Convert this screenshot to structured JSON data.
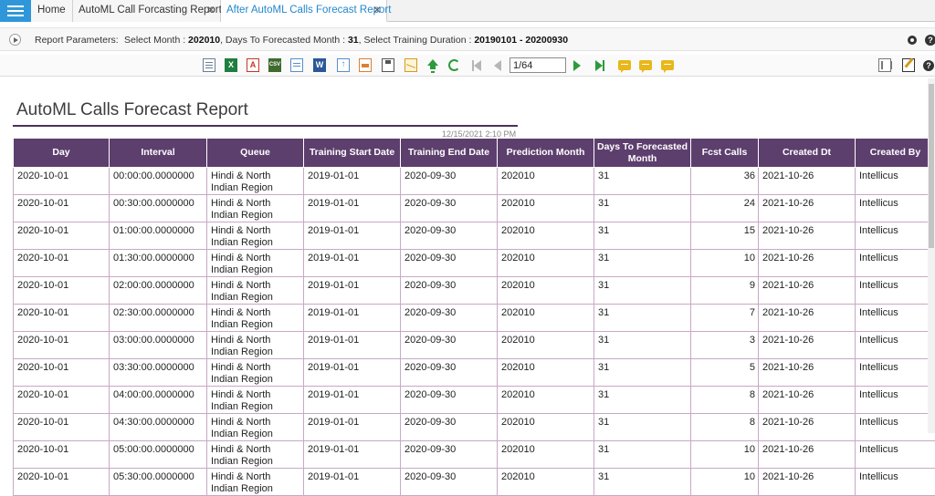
{
  "tabs": [
    {
      "label": "Home"
    },
    {
      "label": "AutoML Call Forcasting Report",
      "close": "✕"
    },
    {
      "label": "After AutoML Calls Forecast Report",
      "close": "✕"
    }
  ],
  "params": {
    "label": "Report Parameters:",
    "pre1": "Select Month : ",
    "val1": "202010",
    "pre2": ", Days To Forecasted Month : ",
    "val2": "31",
    "pre3": ", Select Training Duration : ",
    "val3": "20190101 - 20200930"
  },
  "toolbar": {
    "page_value": "1/64",
    "xls_glyph": "X",
    "pdf_glyph": "A",
    "csv_glyph": "CSV",
    "word_glyph": "W",
    "help_glyph": "?"
  },
  "report": {
    "title": "AutoML Calls Forecast Report",
    "datetime": "12/15/2021  2:10 PM",
    "columns": [
      "Day",
      "Interval",
      "Queue",
      "Training Start Date",
      "Training End Date",
      "Prediction Month",
      "Days To Forecasted Month",
      "Fcst Calls",
      "Created Dt",
      "Created By"
    ],
    "rows": [
      [
        "2020-10-01",
        "00:00:00.0000000",
        "Hindi & North Indian Region",
        "2019-01-01",
        "2020-09-30",
        "202010",
        "31",
        "36",
        "2021-10-26",
        "Intellicus"
      ],
      [
        "2020-10-01",
        "00:30:00.0000000",
        "Hindi & North Indian Region",
        "2019-01-01",
        "2020-09-30",
        "202010",
        "31",
        "24",
        "2021-10-26",
        "Intellicus"
      ],
      [
        "2020-10-01",
        "01:00:00.0000000",
        "Hindi & North Indian Region",
        "2019-01-01",
        "2020-09-30",
        "202010",
        "31",
        "15",
        "2021-10-26",
        "Intellicus"
      ],
      [
        "2020-10-01",
        "01:30:00.0000000",
        "Hindi & North Indian Region",
        "2019-01-01",
        "2020-09-30",
        "202010",
        "31",
        "10",
        "2021-10-26",
        "Intellicus"
      ],
      [
        "2020-10-01",
        "02:00:00.0000000",
        "Hindi & North Indian Region",
        "2019-01-01",
        "2020-09-30",
        "202010",
        "31",
        "9",
        "2021-10-26",
        "Intellicus"
      ],
      [
        "2020-10-01",
        "02:30:00.0000000",
        "Hindi & North Indian Region",
        "2019-01-01",
        "2020-09-30",
        "202010",
        "31",
        "7",
        "2021-10-26",
        "Intellicus"
      ],
      [
        "2020-10-01",
        "03:00:00.0000000",
        "Hindi & North Indian Region",
        "2019-01-01",
        "2020-09-30",
        "202010",
        "31",
        "3",
        "2021-10-26",
        "Intellicus"
      ],
      [
        "2020-10-01",
        "03:30:00.0000000",
        "Hindi & North Indian Region",
        "2019-01-01",
        "2020-09-30",
        "202010",
        "31",
        "5",
        "2021-10-26",
        "Intellicus"
      ],
      [
        "2020-10-01",
        "04:00:00.0000000",
        "Hindi & North Indian Region",
        "2019-01-01",
        "2020-09-30",
        "202010",
        "31",
        "8",
        "2021-10-26",
        "Intellicus"
      ],
      [
        "2020-10-01",
        "04:30:00.0000000",
        "Hindi & North Indian Region",
        "2019-01-01",
        "2020-09-30",
        "202010",
        "31",
        "8",
        "2021-10-26",
        "Intellicus"
      ],
      [
        "2020-10-01",
        "05:00:00.0000000",
        "Hindi & North Indian Region",
        "2019-01-01",
        "2020-09-30",
        "202010",
        "31",
        "10",
        "2021-10-26",
        "Intellicus"
      ],
      [
        "2020-10-01",
        "05:30:00.0000000",
        "Hindi & North Indian Region",
        "2019-01-01",
        "2020-09-30",
        "202010",
        "31",
        "10",
        "2021-10-26",
        "Intellicus"
      ]
    ]
  }
}
